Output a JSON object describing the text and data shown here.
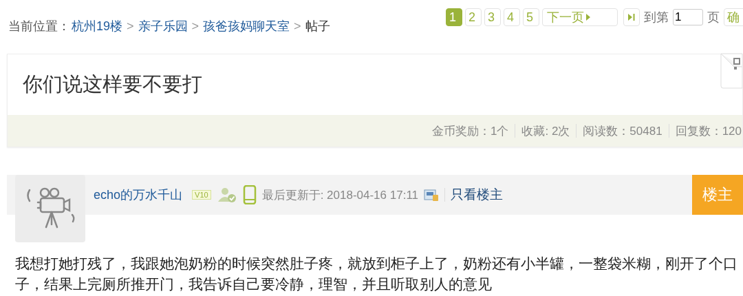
{
  "breadcrumb": [
    {
      "kind": "label",
      "text": "当前位置："
    },
    {
      "kind": "link",
      "text": "杭州19楼"
    },
    {
      "kind": "separator",
      "text": ">"
    },
    {
      "kind": "link",
      "text": "亲子乐园"
    },
    {
      "kind": "separator",
      "text": ">"
    },
    {
      "kind": "link",
      "text": "孩爸孩妈聊天室"
    },
    {
      "kind": "separator",
      "text": ">"
    },
    {
      "kind": "current",
      "text": "帖子"
    }
  ],
  "pager": {
    "pages": [
      {
        "label": "1",
        "selected": true
      },
      {
        "label": "2",
        "selected": false
      },
      {
        "label": "3",
        "selected": false
      },
      {
        "label": "4",
        "selected": false
      },
      {
        "label": "5",
        "selected": false
      }
    ],
    "next": "下一页",
    "goto_label": "到第",
    "page_input": "1",
    "page_unit": "页",
    "confirm": "确"
  },
  "post": {
    "title": "你们说这样要不要打",
    "stats": [
      "金币奖励：1个",
      "收藏: 2次",
      "阅读数：50481",
      "回复数：120"
    ]
  },
  "reply": {
    "author": "echo的万水千山",
    "level_badge": "V10",
    "updated": "最后更新于: 2018-04-16 17:11",
    "only_author": "只看楼主",
    "floor": "楼主",
    "body": "我想打她打残了，我跟她泡奶粉的时候突然肚子疼，就放到柜子上了，奶粉还有小半罐，一整袋米糊，刚开了个口子，结果上完厕所推开门，我告诉自己要冷静，理智，并且听取别人的意见"
  }
}
